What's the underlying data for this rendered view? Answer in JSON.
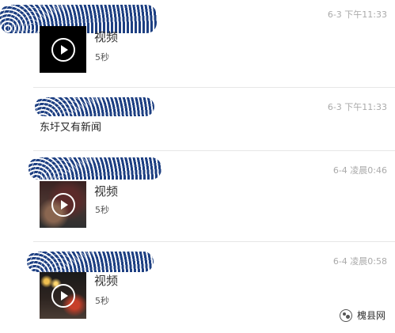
{
  "messages": [
    {
      "type": "video",
      "time": "6-3 下午11:33",
      "title": "视频",
      "duration": "5秒"
    },
    {
      "type": "text",
      "time": "6-3 下午11:33",
      "text": "东圩又有新闻"
    },
    {
      "type": "video",
      "time": "6-4 凌晨0:46",
      "title": "视频",
      "duration": "5秒"
    },
    {
      "type": "video",
      "time": "6-4 凌晨0:58",
      "title": "视频",
      "duration": "5秒"
    }
  ],
  "watermark": {
    "text": "槐县网"
  },
  "colors": {
    "wave": "#1d3f82",
    "time": "#aaaaaa",
    "separator": "#e6e6e6"
  },
  "icons": {
    "play": "play-icon"
  }
}
